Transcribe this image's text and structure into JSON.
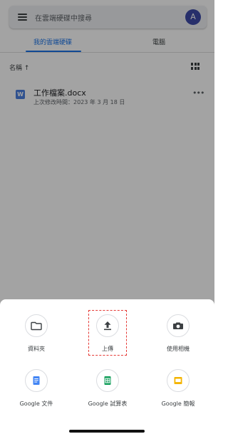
{
  "search": {
    "placeholder": "在雲端硬碟中搜尋"
  },
  "account": {
    "avatar_letter": "A",
    "avatar_color": "#3d4aa8"
  },
  "tabs": [
    {
      "label": "我的雲端硬碟",
      "active": true
    },
    {
      "label": "電腦",
      "active": false
    }
  ],
  "sort": {
    "label": "名稱 ↑"
  },
  "files": [
    {
      "icon_letter": "W",
      "name": "工作檔案.docx",
      "meta": "上次修改時間：2023 年 3 月 18 日"
    }
  ],
  "sheet": {
    "actions": [
      {
        "label": "資料夾",
        "icon": "folder-icon"
      },
      {
        "label": "上傳",
        "icon": "upload-icon",
        "highlighted": true
      },
      {
        "label": "使用相機",
        "icon": "camera-icon"
      },
      {
        "label": "Google 文件",
        "icon": "google-docs-icon"
      },
      {
        "label": "Google 試算表",
        "icon": "google-sheets-icon"
      },
      {
        "label": "Google 簡報",
        "icon": "google-slides-icon"
      }
    ]
  },
  "colors": {
    "accent": "#1a73e8",
    "highlight_border": "#e53935",
    "docs": "#4285f4",
    "sheets": "#0f9d58",
    "slides": "#f4b400"
  }
}
